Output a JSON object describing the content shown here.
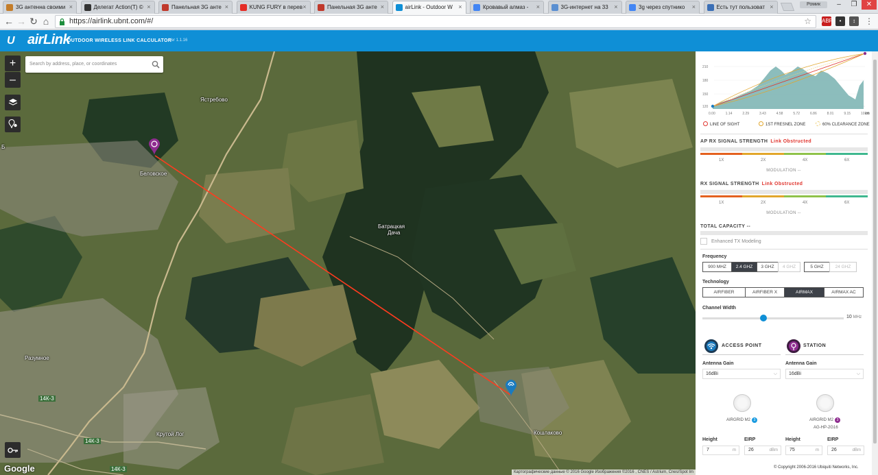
{
  "browser": {
    "tabs": [
      {
        "title": "3G антенна своими",
        "icon": "ubuntu-icon",
        "color": "#c47d2a",
        "active": false
      },
      {
        "title": "Делегат Action(T) ©",
        "icon": "m-icon",
        "color": "#333333",
        "active": false
      },
      {
        "title": "Панельная 3G анте",
        "icon": "flag-icon",
        "color": "#c0392b",
        "active": false
      },
      {
        "title": "KUNG FURY в перев",
        "icon": "youtube-icon",
        "color": "#e52d27",
        "active": false
      },
      {
        "title": "Панельная 3G анте",
        "icon": "flag-icon",
        "color": "#c0392b",
        "active": false
      },
      {
        "title": "airLink - Outdoor W",
        "icon": "ubnt-icon",
        "color": "#0f8fd6",
        "active": true
      },
      {
        "title": "Кровавый алмаз - ",
        "icon": "google-icon",
        "color": "#4285f4",
        "active": false
      },
      {
        "title": "3G-интернет на 33",
        "icon": "site-icon",
        "color": "#5a8fd1",
        "active": false
      },
      {
        "title": "3g через спутнико",
        "icon": "google-icon",
        "color": "#4285f4",
        "active": false
      },
      {
        "title": "Есть тут пользоват",
        "icon": "forum-icon",
        "color": "#3b6fb6",
        "active": false
      }
    ],
    "user_label": "Ромик",
    "window_controls": [
      "–",
      "❐",
      "✕"
    ],
    "url": "https://airlink.ubnt.com/#/",
    "extensions": [
      "ABP",
      "•",
      "↕",
      "⬇"
    ]
  },
  "app": {
    "logo": "U",
    "brand": "airLink",
    "subtitle": "OUTDOOR WIRELESS LINK CALCULATOR",
    "version": "Ver 1.1.16"
  },
  "map": {
    "search_placeholder": "Search by address, place, or coordinates",
    "zoom_in": "+",
    "zoom_out": "–",
    "labels": {
      "yastrebovo": "Ястребово",
      "belovskoe": "Беловское",
      "batratskaya": "Батрацкая",
      "dacha": "Дача",
      "razumnoe": "Разумное",
      "krutoy_log": "Крутой Лог",
      "koshlakovo": "Кошлаково",
      "road_14k3_a": "14К-3",
      "road_14k3_b": "14К-3",
      "road_14k3_c": "14К-3",
      "left_road": "Б"
    },
    "google": "Google",
    "attribution": "Картографические данные © 2016 Google Изображения ©2016 , CNES / Astrium, Cnes/Spot Im"
  },
  "profile": {
    "y_ticks": [
      "210",
      "180",
      "150",
      "120"
    ],
    "x_ticks": [
      "0.00",
      "1.14",
      "2.29",
      "3.43",
      "4.58",
      "5.72",
      "6.86",
      "8.01",
      "9.15",
      "10.30"
    ],
    "x_unit": "km",
    "legend": [
      {
        "label": "LINE OF SIGHT",
        "color": "#e0342d"
      },
      {
        "label": "1ST FRESNEL ZONE",
        "color": "#e2a62b"
      },
      {
        "label": "60% CLEARANCE ZONE",
        "color": "#f0d27a"
      }
    ]
  },
  "ap_signal": {
    "title": "AP RX SIGNAL STRENGTH",
    "status": "Link Obstructed",
    "ticks": [
      "1X",
      "2X",
      "4X",
      "6X"
    ],
    "modulation": "MODULATION --"
  },
  "rx_signal": {
    "title": "RX SIGNAL STRENGTH",
    "status": "Link Obstructed",
    "ticks": [
      "1X",
      "2X",
      "4X",
      "6X"
    ],
    "modulation": "MODULATION --"
  },
  "capacity": {
    "title": "TOTAL CAPACITY",
    "value": "--",
    "enhanced": "Enhanced TX Modeling"
  },
  "frequency": {
    "label": "Frequency",
    "options": [
      {
        "label": "900 MHZ",
        "state": "normal"
      },
      {
        "label": "2.4 GHZ",
        "state": "on"
      },
      {
        "label": "3 GHZ",
        "state": "normal"
      },
      {
        "label": "4 GHZ",
        "state": "dis"
      },
      {
        "label": "5 GHZ",
        "state": "normal"
      },
      {
        "label": "24 GHZ",
        "state": "dis"
      }
    ]
  },
  "technology": {
    "label": "Technology",
    "options": [
      {
        "label": "AIRFIBER",
        "state": "normal"
      },
      {
        "label": "AIRFIBER X",
        "state": "normal"
      },
      {
        "label": "AIRMAX",
        "state": "on"
      },
      {
        "label": "AIRMAX AC",
        "state": "normal"
      }
    ]
  },
  "channel": {
    "label": "Channel Width",
    "value": "10",
    "unit": "MHz",
    "fraction": 0.43
  },
  "access_point": {
    "title": "ACCESS POINT",
    "gain_label": "Antenna Gain",
    "gain": "16dBi",
    "product": "AIRGRID M2",
    "badge": "3",
    "height_label": "Height",
    "height": "7",
    "height_unit": "m",
    "eirp_label": "EIRP",
    "eirp": "26",
    "eirp_unit": "dBm"
  },
  "station": {
    "title": "STATION",
    "gain_label": "Antenna Gain",
    "gain": "16dBi",
    "product": "AIRGRID M2",
    "badge": "3",
    "model": "AG-HP-2G16",
    "height_label": "Height",
    "height": "75",
    "height_unit": "m",
    "eirp_label": "EIRP",
    "eirp": "26",
    "eirp_unit": "dBm"
  },
  "footer": {
    "copyright": "© Copyright 2006-2016 Ubiquiti Networks, Inc."
  },
  "colors": {
    "accent": "#0f8fd6",
    "obstructed": "#e0342d",
    "ap": "#1a7bbf",
    "station": "#8e2c8f"
  }
}
